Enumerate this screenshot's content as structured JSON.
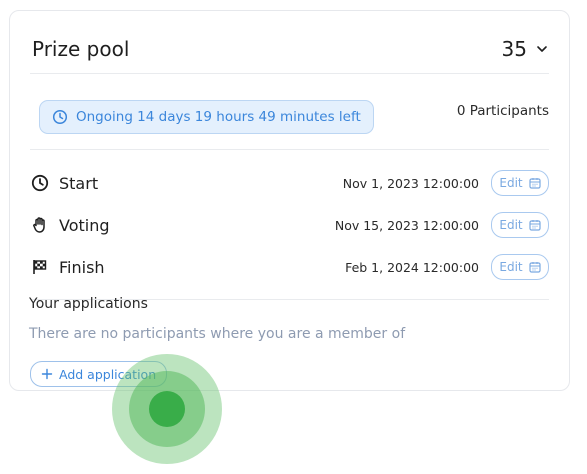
{
  "header": {
    "title": "Prize pool",
    "count": "35"
  },
  "status": {
    "label": "Ongoing 14 days 19 hours 49 minutes left",
    "participants": "0 Participants"
  },
  "phases": [
    {
      "name": "Start",
      "date": "Nov 1, 2023 12:00:00",
      "edit": "Edit",
      "icon": "clock-icon"
    },
    {
      "name": "Voting",
      "date": "Nov 15, 2023 12:00:00",
      "edit": "Edit",
      "icon": "hand-icon"
    },
    {
      "name": "Finish",
      "date": "Feb 1, 2024 12:00:00",
      "edit": "Edit",
      "icon": "checkered-flag-icon"
    }
  ],
  "applications": {
    "title": "Your applications",
    "empty": "There are no participants where you are a member of",
    "add_label": "Add application"
  },
  "colors": {
    "accent": "#3b86db",
    "pill_bg": "#e4f0fd",
    "cursor": "#39ad49"
  }
}
